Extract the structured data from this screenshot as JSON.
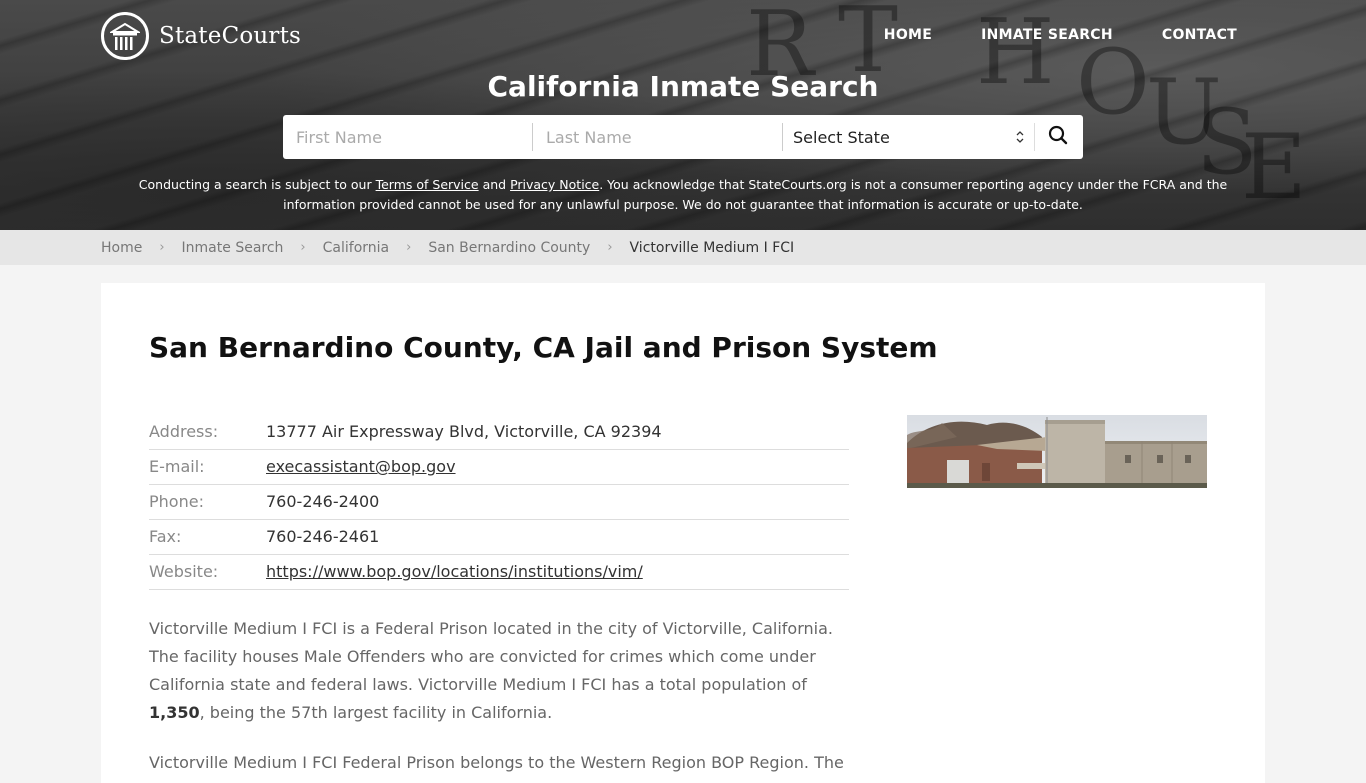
{
  "brand": {
    "name": "StateCourts",
    "logo_icon": "courthouse-columns-icon"
  },
  "nav": {
    "items": [
      {
        "label": "HOME"
      },
      {
        "label": "INMATE SEARCH"
      },
      {
        "label": "CONTACT"
      }
    ]
  },
  "hero": {
    "title": "California Inmate Search",
    "search": {
      "first_name_placeholder": "First Name",
      "last_name_placeholder": "Last Name",
      "first_name_value": "",
      "last_name_value": "",
      "state_selected": "Select State",
      "search_icon": "search-icon"
    },
    "disclaimer": {
      "part1": "Conducting a search is subject to our ",
      "terms_link": "Terms of Service",
      "part2": " and ",
      "privacy_link": "Privacy Notice",
      "part3": ". You acknowledge that StateCourts.org is not a consumer reporting agency under the FCRA and the information provided cannot be used for any unlawful purpose. We do not guarantee that information is accurate or up-to-date."
    }
  },
  "breadcrumb": {
    "items": [
      {
        "label": "Home"
      },
      {
        "label": "Inmate Search"
      },
      {
        "label": "California"
      },
      {
        "label": "San Bernardino County"
      }
    ],
    "current": "Victorville Medium I FCI",
    "separator_icon": "chevron-right-icon"
  },
  "main": {
    "title": "San Bernardino County, CA Jail and Prison System",
    "details": [
      {
        "label": "Address:",
        "value": "13777 Air Expressway Blvd, Victorville, CA 92394",
        "link": false
      },
      {
        "label": "E-mail:",
        "value": "execassistant@bop.gov",
        "link": true
      },
      {
        "label": "Phone:",
        "value": "760-246-2400",
        "link": false
      },
      {
        "label": "Fax:",
        "value": "760-246-2461",
        "link": false
      },
      {
        "label": "Website:",
        "value": "https://www.bop.gov/locations/institutions/vim/",
        "link": true
      }
    ],
    "photo_alt": "Victorville Medium I FCI facility building",
    "paragraph1": {
      "before": "Victorville Medium I FCI is a Federal Prison located in the city of Victorville, California. The facility houses Male Offenders who are convicted for crimes which come under California state and federal laws. Victorville Medium I FCI has a total population of ",
      "population": "1,350",
      "after": ", being the 57th largest facility in California."
    },
    "paragraph2": "Victorville Medium I FCI Federal Prison belongs to the Western Region BOP Region. The"
  }
}
